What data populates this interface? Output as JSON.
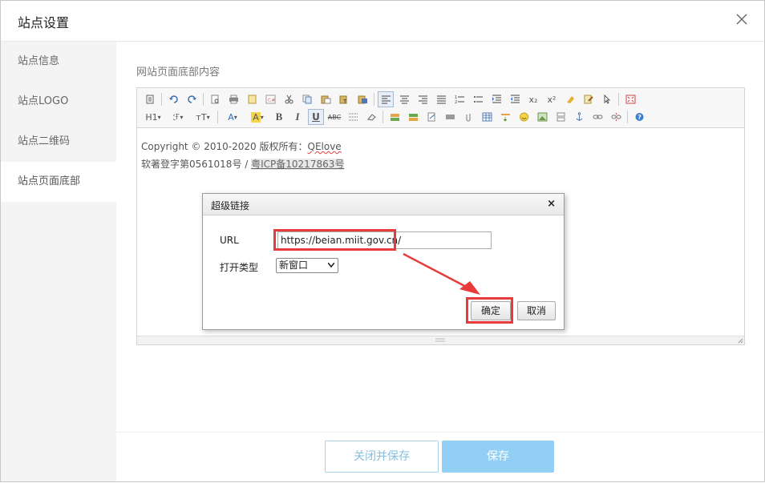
{
  "dialog": {
    "title": "站点设置"
  },
  "sidebar": {
    "items": [
      {
        "label": "站点信息"
      },
      {
        "label": "站点LOGO"
      },
      {
        "label": "站点二维码"
      },
      {
        "label": "站点页面底部"
      }
    ]
  },
  "main": {
    "section_label": "网站页面底部内容",
    "toolbar_text": {
      "heading": "H1",
      "font_family": "ℱ",
      "font_size": "тT",
      "font_color": "A",
      "highlight": "A",
      "bold": "B",
      "italic": "I",
      "underline": "U",
      "strike": "ABC",
      "subscript": "x₂",
      "superscript": "x²"
    },
    "editor_content": {
      "line1_prefix": "Copyright © 2010-2020   版权所有：",
      "line1_name": "QElove",
      "line2_prefix": "软著登字第0561018号 / ",
      "line2_link": "粤ICP备10217863号"
    }
  },
  "footer": {
    "close_save_label": "关闭并保存",
    "save_label": "保存"
  },
  "link_popup": {
    "title": "超级链接",
    "close_glyph": "×",
    "url_label": "URL",
    "url_value": "https://beian.miit.gov.cn/",
    "open_type_label": "打开类型",
    "open_type_value": "新窗口",
    "ok_label": "确定",
    "cancel_label": "取消"
  },
  "colors": {
    "annotation_red": "#e83a3a",
    "save_button": "#92cff4",
    "sidebar_bg": "#f4f4f4"
  }
}
